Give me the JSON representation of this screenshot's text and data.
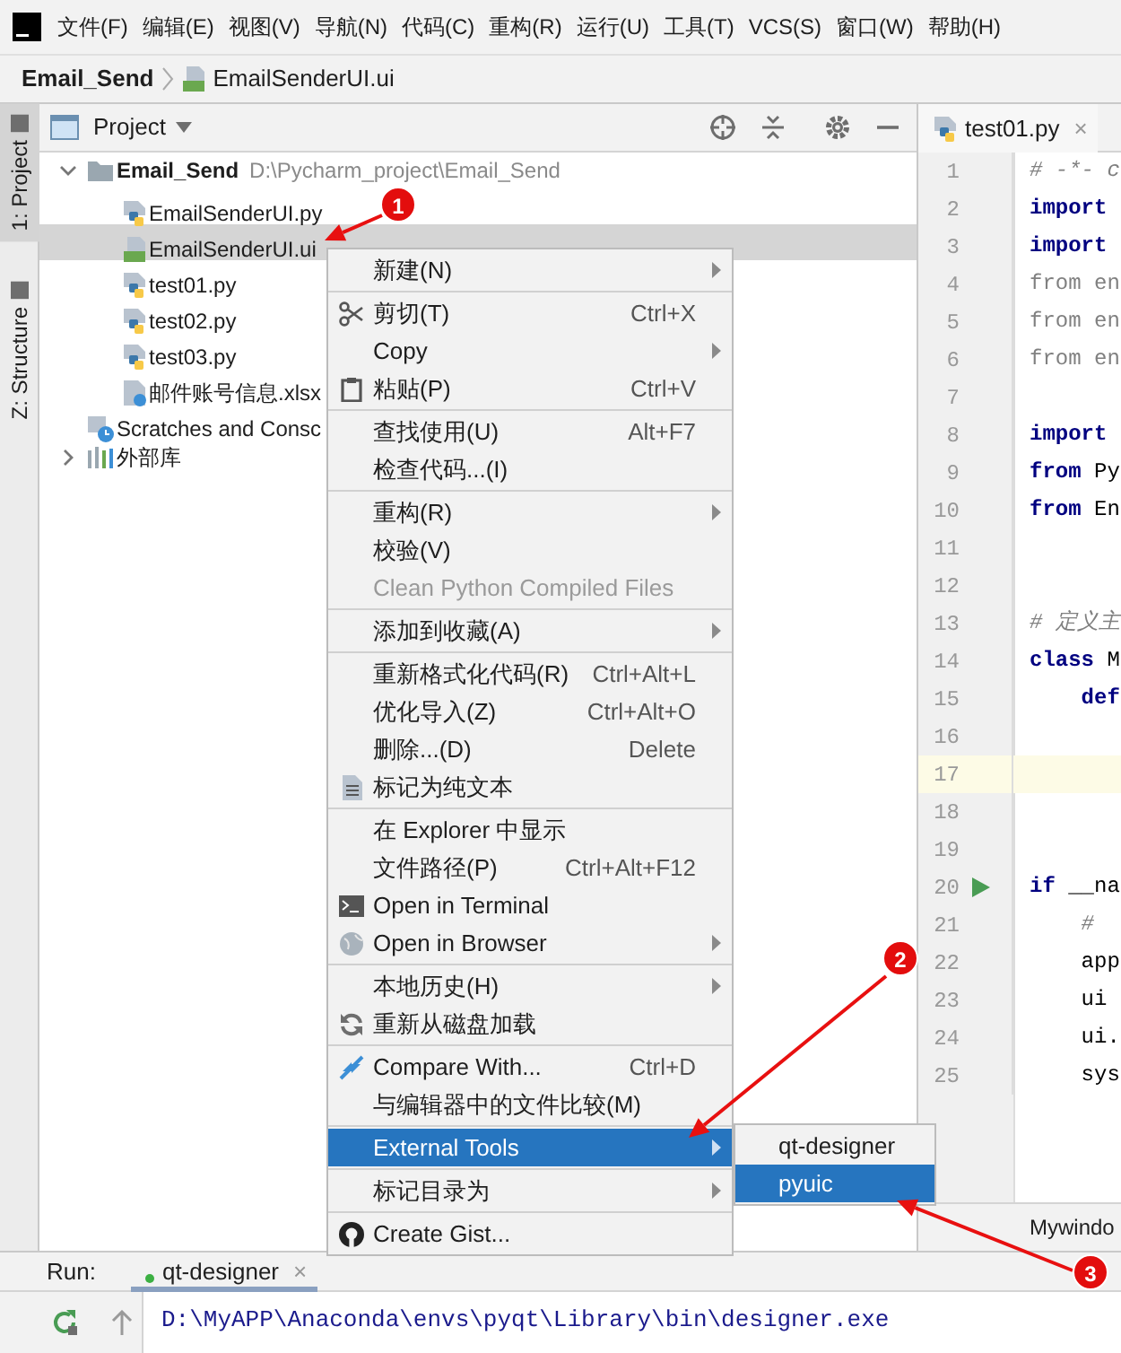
{
  "menubar": {
    "items": [
      "文件(F)",
      "编辑(E)",
      "视图(V)",
      "导航(N)",
      "代码(C)",
      "重构(R)",
      "运行(U)",
      "工具(T)",
      "VCS(S)",
      "窗口(W)",
      "帮助(H)"
    ]
  },
  "breadcrumb": [
    {
      "label": "Email_Send",
      "kind": "project"
    },
    {
      "label": "EmailSenderUI.ui",
      "kind": "qt"
    }
  ],
  "tool_strip": [
    {
      "label": "1: Project",
      "selected": true
    },
    {
      "label": "Z: Structure",
      "selected": false
    }
  ],
  "project_panel": {
    "title": "Project",
    "tree": [
      {
        "label": "Email_Send",
        "kind": "folder",
        "path": "D:\\Pycharm_project\\Email_Send",
        "expanded": true,
        "selected": false,
        "children": [
          {
            "label": "EmailSenderUI.py",
            "kind": "py",
            "selected": false
          },
          {
            "label": "EmailSenderUI.ui",
            "kind": "qt",
            "selected": true
          },
          {
            "label": "test01.py",
            "kind": "py",
            "selected": false
          },
          {
            "label": "test02.py",
            "kind": "py",
            "selected": false
          },
          {
            "label": "test03.py",
            "kind": "py",
            "selected": false
          },
          {
            "label": "邮件账号信息.xlsx",
            "kind": "xlsx",
            "selected": false
          }
        ]
      },
      {
        "label": "Scratches and Consc",
        "kind": "scratches",
        "selected": false
      },
      {
        "label": "外部库",
        "kind": "library",
        "expanded": false,
        "selected": false
      }
    ]
  },
  "editor": {
    "tabs": [
      {
        "label": "test01.py",
        "close": "×",
        "selected": true
      }
    ],
    "lines": [
      {
        "number": "1",
        "tokens": [
          {
            "text": "# -*- c",
            "kind": "comment"
          }
        ]
      },
      {
        "number": "2",
        "tokens": [
          {
            "text": "import",
            "kind": "keyword"
          }
        ]
      },
      {
        "number": "3",
        "tokens": [
          {
            "text": "import",
            "kind": "keyword"
          }
        ]
      },
      {
        "number": "4",
        "tokens": [
          {
            "text": "from en",
            "kind": "unused"
          }
        ]
      },
      {
        "number": "5",
        "tokens": [
          {
            "text": "from en",
            "kind": "unused"
          }
        ]
      },
      {
        "number": "6",
        "tokens": [
          {
            "text": "from en",
            "kind": "unused"
          }
        ]
      },
      {
        "number": "7"
      },
      {
        "number": "8",
        "tokens": [
          {
            "text": "import",
            "kind": "keyword"
          }
        ]
      },
      {
        "number": "9",
        "tokens": [
          {
            "text": "from",
            "kind": "keyword"
          },
          {
            "text": " Py",
            "kind": "plain"
          }
        ]
      },
      {
        "number": "10",
        "tokens": [
          {
            "text": "from",
            "kind": "keyword"
          },
          {
            "text": " En",
            "kind": "plain"
          }
        ]
      },
      {
        "number": "11"
      },
      {
        "number": "12"
      },
      {
        "number": "13",
        "tokens": [
          {
            "text": "# 定义主",
            "kind": "comment"
          }
        ]
      },
      {
        "number": "14",
        "tokens": [
          {
            "text": "class",
            "kind": "keyword"
          },
          {
            "text": " M",
            "kind": "plain"
          }
        ]
      },
      {
        "number": "15",
        "tokens": [
          {
            "text": "    def",
            "kind": "keyword"
          }
        ]
      },
      {
        "number": "16"
      },
      {
        "number": "17",
        "current": true
      },
      {
        "number": "18"
      },
      {
        "number": "19"
      },
      {
        "number": "20",
        "tokens": [
          {
            "text": "if",
            "kind": "keyword"
          },
          {
            "text": " __na",
            "kind": "plain"
          }
        ],
        "run": true
      },
      {
        "number": "21",
        "tokens": [
          {
            "text": "    #",
            "kind": "comment"
          }
        ]
      },
      {
        "number": "22",
        "tokens": [
          {
            "text": "    app",
            "kind": "plain"
          }
        ]
      },
      {
        "number": "23",
        "tokens": [
          {
            "text": "    ui",
            "kind": "plain"
          }
        ]
      },
      {
        "number": "24",
        "tokens": [
          {
            "text": "    ui.",
            "kind": "plain"
          }
        ]
      },
      {
        "number": "25",
        "tokens": [
          {
            "text": "    sys",
            "kind": "plain"
          }
        ]
      }
    ],
    "footer": "Mywindo"
  },
  "context_menu": {
    "items": [
      {
        "kind": "item",
        "label": "新建(N)",
        "submenu": true,
        "disabled": false,
        "selected": false
      },
      {
        "kind": "separator"
      },
      {
        "kind": "item",
        "label": "剪切(T)",
        "shortcut": "Ctrl+X",
        "submenu": false,
        "disabled": false,
        "selected": false
      },
      {
        "kind": "item",
        "label": "Copy",
        "submenu": true,
        "disabled": false,
        "selected": false
      },
      {
        "kind": "item",
        "label": "粘贴(P)",
        "shortcut": "Ctrl+V",
        "submenu": false,
        "disabled": false,
        "selected": false
      },
      {
        "kind": "separator"
      },
      {
        "kind": "item",
        "label": "查找使用(U)",
        "shortcut": "Alt+F7",
        "submenu": false,
        "disabled": false,
        "selected": false
      },
      {
        "kind": "item",
        "label": "检查代码...(I)",
        "submenu": false,
        "disabled": false,
        "selected": false
      },
      {
        "kind": "separator"
      },
      {
        "kind": "item",
        "label": "重构(R)",
        "submenu": true,
        "disabled": false,
        "selected": false
      },
      {
        "kind": "item",
        "label": "校验(V)",
        "submenu": false,
        "disabled": false,
        "selected": false
      },
      {
        "kind": "item",
        "label": "Clean Python Compiled Files",
        "submenu": false,
        "disabled": true,
        "selected": false
      },
      {
        "kind": "separator"
      },
      {
        "kind": "item",
        "label": "添加到收藏(A)",
        "submenu": true,
        "disabled": false,
        "selected": false
      },
      {
        "kind": "separator"
      },
      {
        "kind": "item",
        "label": "重新格式化代码(R)",
        "shortcut": "Ctrl+Alt+L",
        "submenu": false,
        "disabled": false,
        "selected": false
      },
      {
        "kind": "item",
        "label": "优化导入(Z)",
        "shortcut": "Ctrl+Alt+O",
        "submenu": false,
        "disabled": false,
        "selected": false
      },
      {
        "kind": "item",
        "label": "删除...(D)",
        "shortcut": "Delete",
        "submenu": false,
        "disabled": false,
        "selected": false
      },
      {
        "kind": "item",
        "label": "标记为纯文本",
        "submenu": false,
        "disabled": false,
        "selected": false
      },
      {
        "kind": "separator"
      },
      {
        "kind": "item",
        "label": "在 Explorer 中显示",
        "submenu": false,
        "disabled": false,
        "selected": false
      },
      {
        "kind": "item",
        "label": "文件路径(P)",
        "shortcut": "Ctrl+Alt+F12",
        "submenu": false,
        "disabled": false,
        "selected": false
      },
      {
        "kind": "item",
        "label": "Open in Terminal",
        "submenu": false,
        "disabled": false,
        "selected": false
      },
      {
        "kind": "item",
        "label": "Open in Browser",
        "submenu": true,
        "disabled": false,
        "selected": false
      },
      {
        "kind": "separator"
      },
      {
        "kind": "item",
        "label": "本地历史(H)",
        "submenu": true,
        "disabled": false,
        "selected": false
      },
      {
        "kind": "item",
        "label": "重新从磁盘加载",
        "submenu": false,
        "disabled": false,
        "selected": false
      },
      {
        "kind": "separator"
      },
      {
        "kind": "item",
        "label": "Compare With...",
        "shortcut": "Ctrl+D",
        "submenu": false,
        "disabled": false,
        "selected": false
      },
      {
        "kind": "item",
        "label": "与编辑器中的文件比较(M)",
        "submenu": false,
        "disabled": false,
        "selected": false
      },
      {
        "kind": "separator"
      },
      {
        "kind": "item",
        "label": "External Tools",
        "submenu": true,
        "disabled": false,
        "selected": true
      },
      {
        "kind": "separator"
      },
      {
        "kind": "item",
        "label": "标记目录为",
        "submenu": true,
        "disabled": false,
        "selected": false
      },
      {
        "kind": "separator"
      },
      {
        "kind": "item",
        "label": "Create Gist...",
        "submenu": false,
        "disabled": false,
        "selected": false
      }
    ]
  },
  "submenu": {
    "items": [
      {
        "label": "qt-designer",
        "selected": false
      },
      {
        "label": "pyuic",
        "selected": true
      }
    ]
  },
  "run_panel": {
    "label": "Run:",
    "tabs": [
      {
        "label": "qt-designer",
        "close": "×",
        "selected": true,
        "running": true
      }
    ],
    "output": "D:\\MyAPP\\Anaconda\\envs\\pyqt\\Library\\bin\\designer.exe"
  },
  "annotations": [
    {
      "label": "1"
    },
    {
      "label": "2"
    },
    {
      "label": "3"
    }
  ]
}
